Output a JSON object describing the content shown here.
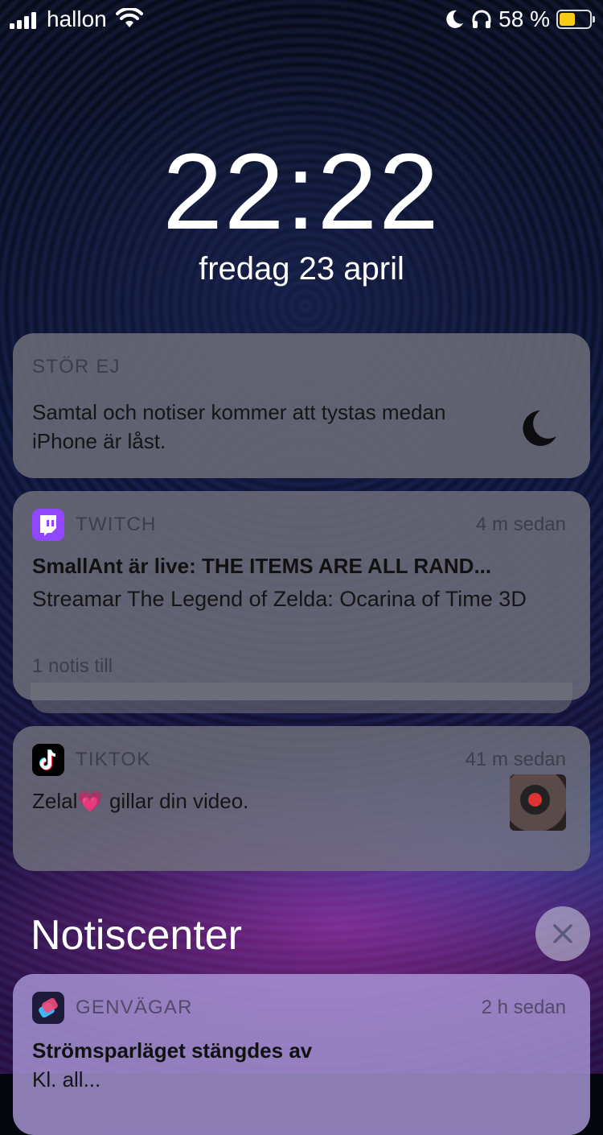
{
  "status": {
    "carrier": "hallon",
    "battery_percent": "58 %",
    "battery_level": 0.58,
    "icons": [
      "signal-icon",
      "wifi-icon",
      "moon-icon",
      "headphones-icon",
      "battery-icon"
    ]
  },
  "lock": {
    "time": "22:22",
    "date": "fredag 23 april"
  },
  "dnd": {
    "title": "STÖR EJ",
    "body": "Samtal och notiser kommer att tystas medan iPhone är låst.",
    "icon": "moon-icon"
  },
  "twitch": {
    "app": "TWITCH",
    "time": "4 m sedan",
    "title": "SmallAnt är live: THE ITEMS ARE ALL RAND...",
    "body": "Streamar The Legend of Zelda: Ocarina of Time 3D",
    "more": "1 notis till",
    "brand_color": "#9146ff"
  },
  "tiktok": {
    "app": "TIKTOK",
    "time": "41 m sedan",
    "body": "Zelal💗 gillar din video.",
    "brand_color": "#000000"
  },
  "notification_center": {
    "title": "Notiscenter"
  },
  "shortcuts": {
    "app": "GENVÄGAR",
    "time": "2 h sedan",
    "title": "Strömsparläget stängdes av",
    "body": "Kl. all..."
  }
}
